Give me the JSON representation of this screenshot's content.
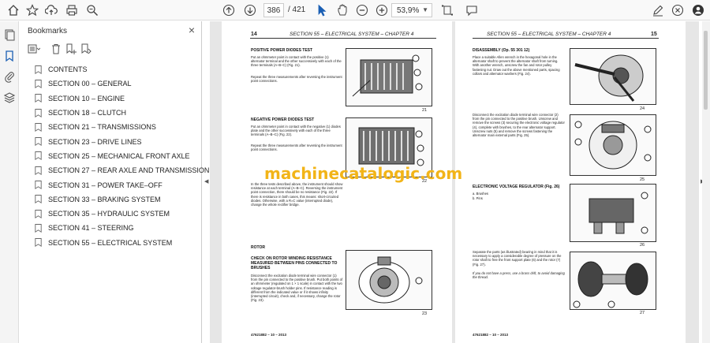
{
  "toolbar": {
    "current_page": "386",
    "total_pages": "/ 421",
    "zoom": "53,9%"
  },
  "bookmarks": {
    "title": "Bookmarks",
    "items": [
      {
        "label": "CONTENTS"
      },
      {
        "label": "SECTION 00 – GENERAL"
      },
      {
        "label": "SECTION 10 – ENGINE"
      },
      {
        "label": "SECTION 18 – CLUTCH"
      },
      {
        "label": "SECTION 21 – TRANSMISSIONS"
      },
      {
        "label": "SECTION 23 – DRIVE LINES"
      },
      {
        "label": "SECTION 25 – MECHANICAL FRONT AXLE"
      },
      {
        "label": "SECTION 27 – REAR AXLE AND TRANSMISSION"
      },
      {
        "label": "SECTION 31 – POWER TAKE–OFF"
      },
      {
        "label": "SECTION 33 – BRAKING SYSTEM"
      },
      {
        "label": "SECTION 35 – HYDRAULIC SYSTEM"
      },
      {
        "label": "SECTION 41 – STEERING"
      },
      {
        "label": "SECTION 55 – ELECTRICAL SYSTEM"
      }
    ]
  },
  "watermark": "machinecatalogic.com",
  "left_page": {
    "number": "14",
    "header": "SECTION 55 – ELECTRICAL SYSTEM – CHAPTER 4",
    "s1_title": "POSITIVE POWER DIODES TEST",
    "s1_text": "Put an ohmmeter point in contact with the positive (1) alternator terminal and the other successively with each of the three terminals (A–B–C) (Fig. 21).",
    "s1_text2": "Repeat the three measurements after reversing the instrument point connections.",
    "fig21": "21",
    "s2_title": "NEGATIVE POWER DIODES TEST",
    "s2_text": "Put an ohmmeter point in contact with the negative (1) diodes plate and the other successively with each of the three terminals (A–B–C) (Fig. 22).",
    "s2_text2": "Repeat the three measurements after reversing the instrument point connections.",
    "fig22": "22",
    "s3_text": "In the three tests described above, the instrument should show resistance at each terminal (A–B–C). Reversing the instrument point connection, there should be no resistance (Fig. 22). If there is resistance in both cases, this means: short-circuited diodes. Otherwise, with a R=C value (interrupted diode), change the whole rectifier bridge.",
    "s4_title": "ROTOR",
    "s5_title": "CHECK ON ROTOR WINDING RESISTANCE MEASURED BETWEEN PINS CONNECTED TO BRUSHES",
    "s5_text": "Disconnect the excitation diode terminal wire connector (1) from the pin connected to the positive brush. Put both points of an ohmmeter (regulated on 1 × 1 scale) in contact with the two voltage regulator-brush holder pins. If resistance reading is different from the indicated value or if it shows infinity (interrupted circuit), check and, if necessary, change the rotor (Fig. 23).",
    "fig23": "23",
    "footer": "47621882 – 10 – 2013"
  },
  "right_page": {
    "number": "15",
    "header": "SECTION 55 – ELECTRICAL SYSTEM – CHAPTER 4",
    "s1_title": "DISASSEMBLY (Op. 55 301 12)",
    "s1_text": "Place a suitable Allen wrench in the hexagonal hole in the alternator shaft to prevent the alternator shaft from turning. With another wrench, unscrew the fan and rotor pulley fastening nut. Draw out the above mentioned parts, spacing collars and alternator washers (Fig. 24).",
    "fig24": "24",
    "s2_text": "Disconnect the excitation diode terminal wire connector (2) from the pin connected to the positive brush. Unscrew and remove the screws (3) securing the electronic voltage regulator (4), complete with brushes, to the rear alternator support. Unscrew nuts (5) and remove the screws fastening the alternator main external parts (Fig. 25).",
    "fig25": "25",
    "s3_title": "ELECTRONIC VOLTAGE REGULATOR (Fig. 26)",
    "s3_a": "a. Brushes",
    "s3_b": "b. Pins",
    "fig26": "26",
    "s4_text": "Separate the parts (as illustrated) bearing in mind that it is necessary to apply a considerable degree of pressure on the rotor shaft to free the front support plate (6) and the rotor (7) (Fig. 27).",
    "s4_note": "If you do not have a press, use a brass drift, to avoid damaging the thread.",
    "fig27": "27",
    "footer": "47621882 – 10 – 2013"
  }
}
